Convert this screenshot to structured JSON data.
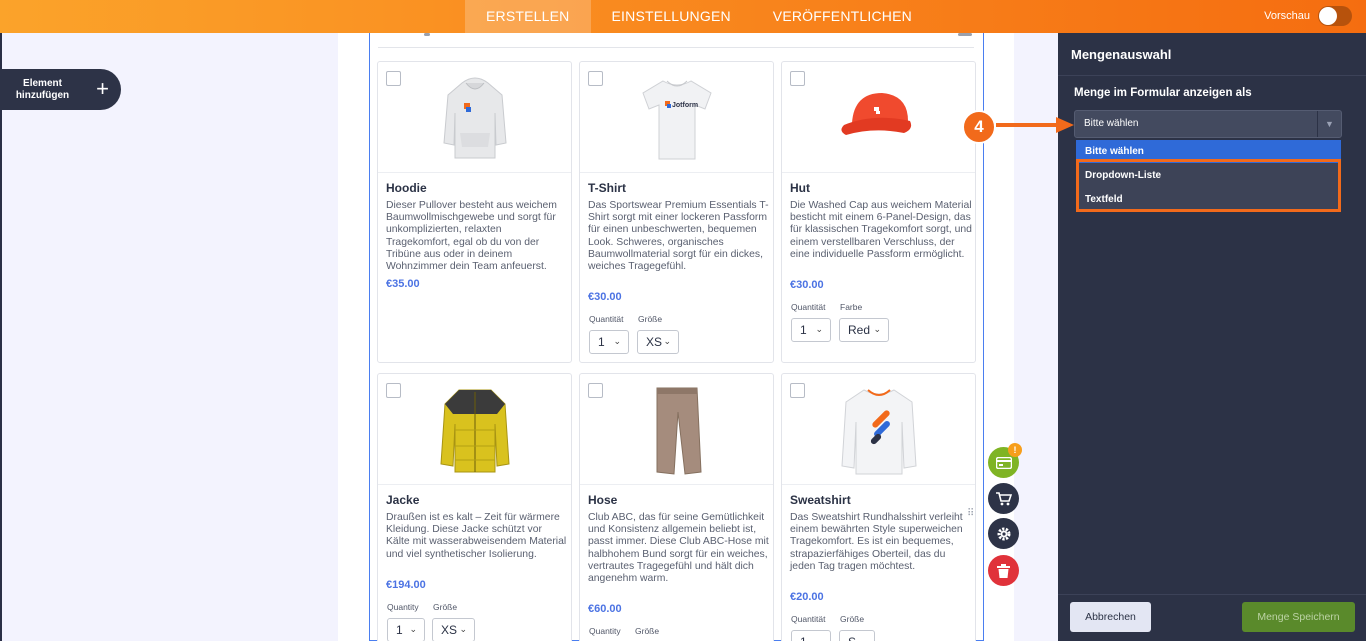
{
  "header": {
    "tabs": [
      "ERSTELLEN",
      "EINSTELLUNGEN",
      "VERÖFFENTLICHEN"
    ],
    "preview_label": "Vorschau"
  },
  "sidebar": {
    "add_element_label": "Element hinzufügen",
    "add_icon": "plus-icon"
  },
  "products": [
    {
      "name": "Hoodie",
      "desc": "Dieser Pullover besteht aus weichem Baumwollmischgewebe und sorgt für unkomplizierten, relaxten Tragekomfort, egal ob du von der Tribüne aus oder in deinem Wohnzimmer dein Team anfeuerst.",
      "price": "€35.00",
      "options": []
    },
    {
      "name": "T-Shirt",
      "desc": "Das Sportswear Premium Essentials T-Shirt sorgt mit einer lockeren Passform für einen unbeschwerten, bequemen Look. Schweres, organisches Baumwollmaterial sorgt für ein dickes, weiches Tragegefühl.",
      "price": "€30.00",
      "options": [
        {
          "label": "Quantität",
          "value": "1"
        },
        {
          "label": "Größe",
          "value": "XS"
        }
      ]
    },
    {
      "name": "Hut",
      "desc": "Die Washed Cap aus weichem Material besticht mit einem 6-Panel-Design, das für klassischen Tragekomfort sorgt, und einem verstellbaren Verschluss, der eine individuelle Passform ermöglicht.",
      "price": "€30.00",
      "options": [
        {
          "label": "Quantität",
          "value": "1"
        },
        {
          "label": "Farbe",
          "value": "Red"
        }
      ]
    },
    {
      "name": "Jacke",
      "desc": "Draußen ist es kalt – Zeit für wärmere Kleidung. Diese Jacke schützt vor Kälte mit wasserabweisendem Material und viel synthetischer Isolierung.",
      "price": "€194.00",
      "options": [
        {
          "label": "Quantity",
          "value": "1"
        },
        {
          "label": "Größe",
          "value": "XS"
        }
      ]
    },
    {
      "name": "Hose",
      "desc": "Club ABC, das für seine Gemütlichkeit und Konsistenz allgemein beliebt ist, passt immer. Diese Club ABC-Hose mit halbhohem Bund sorgt für ein weiches, vertrautes Tragegefühl und hält dich angenehm warm.",
      "price": "€60.00",
      "options": [
        {
          "label": "Quantity",
          "value": ""
        },
        {
          "label": "Größe",
          "value": ""
        }
      ]
    },
    {
      "name": "Sweatshirt",
      "desc": "Das Sweatshirt Rundhalsshirt verleiht einem bewährten Style superweichen Tragekomfort. Es ist ein bequemes, strapazierfähiges Oberteil, das du jeden Tag tragen möchtest.",
      "price": "€20.00",
      "options": [
        {
          "label": "Quantität",
          "value": "1"
        },
        {
          "label": "Größe",
          "value": "S"
        }
      ]
    }
  ],
  "tools": {
    "badge": "!",
    "icons": [
      "payment-card-icon",
      "cart-icon",
      "gear-icon",
      "trash-icon"
    ]
  },
  "panel": {
    "title": "Mengenauswahl",
    "field_label": "Menge im Formular anzeigen als",
    "selected": "Bitte wählen",
    "options": [
      "Bitte wählen",
      "Dropdown-Liste",
      "Textfeld"
    ],
    "cancel": "Abbrechen",
    "save": "Menge Speichern"
  },
  "step_marker": "4",
  "colors": {
    "accent_orange": "#f26a1b",
    "link_blue": "#4c73e3",
    "panel_bg": "#2c3246",
    "highlight_blue": "#2f6ad8",
    "save_green": "#5a8a2b"
  }
}
